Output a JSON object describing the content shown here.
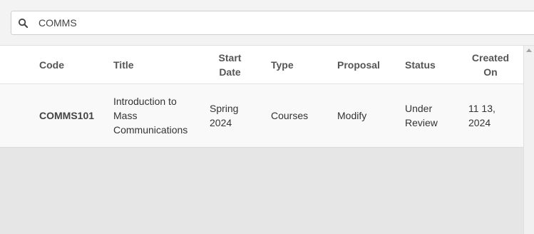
{
  "search": {
    "value": "COMMS"
  },
  "table": {
    "columns": [
      "Code",
      "Title",
      "Start Date",
      "Type",
      "Proposal",
      "Status",
      "Created On"
    ],
    "rows": [
      {
        "code": "COMMS101",
        "title": "Introduction to Mass Communications",
        "start_date": "Spring 2024",
        "type": "Courses",
        "proposal": "Modify",
        "status": "Under Review",
        "created_on": "11 13, 2024"
      }
    ]
  }
}
